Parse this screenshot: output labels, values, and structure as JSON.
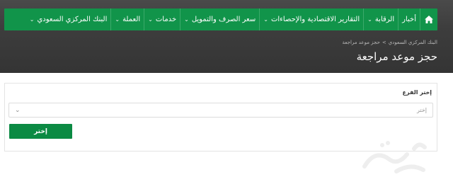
{
  "nav": {
    "items": [
      {
        "label": "أخبار",
        "dropdown": false
      },
      {
        "label": "الرقابة",
        "dropdown": true
      },
      {
        "label": "التقارير الاقتصادية والإحصاءات",
        "dropdown": true
      },
      {
        "label": "سعر الصرف والتمويل",
        "dropdown": true
      },
      {
        "label": "خدمات",
        "dropdown": true
      },
      {
        "label": "العملة",
        "dropdown": true
      },
      {
        "label": "البنك المركزي السعودي",
        "dropdown": true
      }
    ],
    "home_icon": "home-icon",
    "color": "#11944a"
  },
  "breadcrumb": {
    "home": "البنك المركزي السعودي",
    "separator": ">",
    "current": "حجز موعد مراجعة"
  },
  "page": {
    "title": "حجز موعد مراجعة"
  },
  "form": {
    "branch_label": "إختر الفرع",
    "select_value": "إختر",
    "button_label": "إختر",
    "button_color": "#0b8a43"
  }
}
